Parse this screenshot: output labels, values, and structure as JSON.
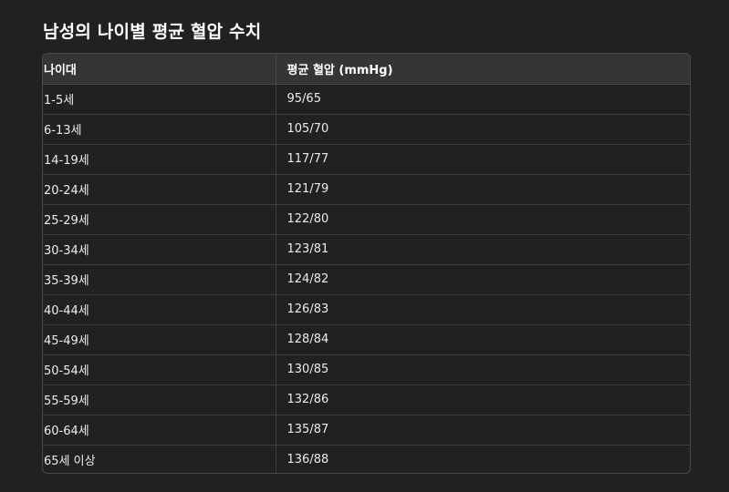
{
  "title": "남성의 나이별 평균 혈압 수치",
  "table": {
    "headers": [
      "나이대",
      "평균 혈압 (mmHg)"
    ],
    "rows": [
      [
        "1-5세",
        "95/65"
      ],
      [
        "6-13세",
        "105/70"
      ],
      [
        "14-19세",
        "117/77"
      ],
      [
        "20-24세",
        "121/79"
      ],
      [
        "25-29세",
        "122/80"
      ],
      [
        "30-34세",
        "123/81"
      ],
      [
        "35-39세",
        "124/82"
      ],
      [
        "40-44세",
        "126/83"
      ],
      [
        "45-49세",
        "128/84"
      ],
      [
        "50-54세",
        "130/85"
      ],
      [
        "55-59세",
        "132/86"
      ],
      [
        "60-64세",
        "135/87"
      ],
      [
        "65세 이상",
        "136/88"
      ]
    ]
  }
}
